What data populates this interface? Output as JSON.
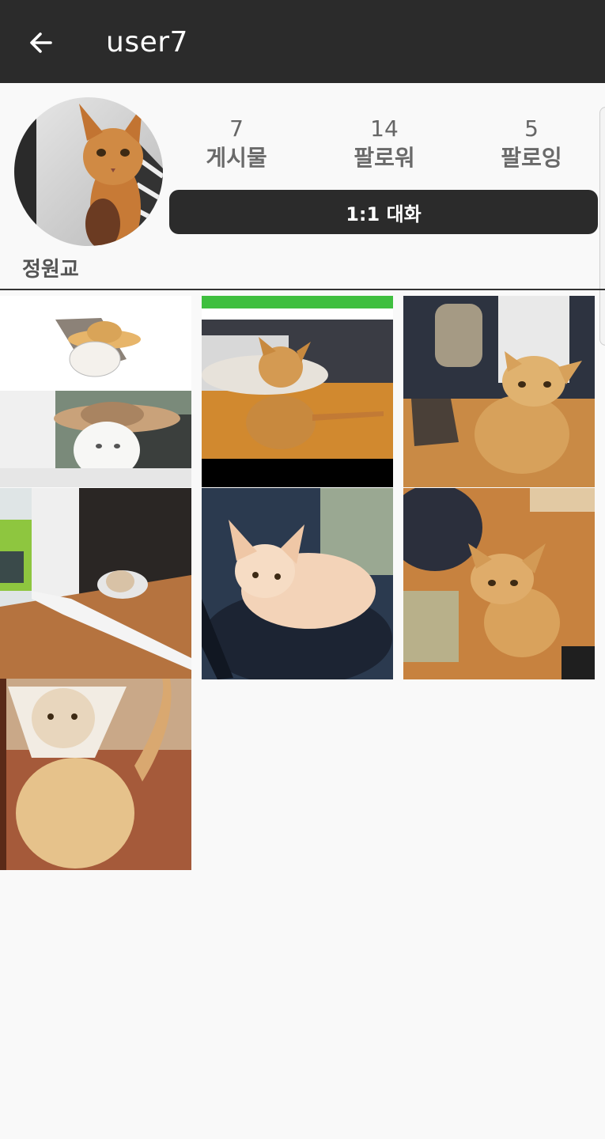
{
  "appbar": {
    "back_icon": "arrow-left-icon",
    "title": "user7"
  },
  "profile": {
    "display_name": "정원교",
    "stats": [
      {
        "count": "7",
        "label": "게시물"
      },
      {
        "count": "14",
        "label": "팔로워"
      },
      {
        "count": "5",
        "label": "팔로잉"
      }
    ],
    "chat_button": "1:1 대화"
  },
  "colors": {
    "appbar": "#2b2b2b",
    "background": "#f9f9f9",
    "button": "#2b2b2b"
  }
}
